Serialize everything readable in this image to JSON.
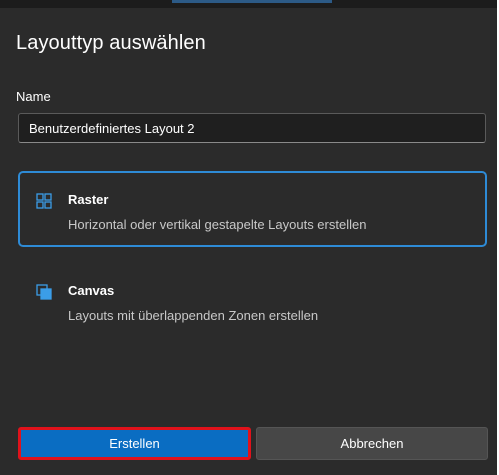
{
  "dialog": {
    "title": "Layouttyp auswählen",
    "name_label": "Name",
    "name_value": "Benutzerdefiniertes Layout 2"
  },
  "options": [
    {
      "title": "Raster",
      "description": "Horizontal oder vertikal gestapelte Layouts erstellen",
      "icon": "grid-icon",
      "selected": true
    },
    {
      "title": "Canvas",
      "description": "Layouts mit überlappenden Zonen erstellen",
      "icon": "canvas-icon",
      "selected": false
    }
  ],
  "buttons": {
    "create_label": "Erstellen",
    "cancel_label": "Abbrechen"
  },
  "colors": {
    "accent": "#2e8bd6",
    "primary_button": "#0a6dc2",
    "highlight_border": "#e0121b",
    "background": "#2b2b2b"
  }
}
